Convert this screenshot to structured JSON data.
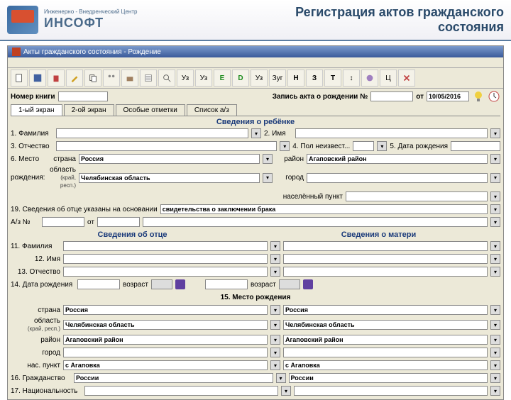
{
  "slide": {
    "logo_small": "Инженерно - Внедренческий Центр",
    "logo_big": "ИНСОФТ",
    "title_l1": "Регистрация актов гражданского",
    "title_l2": "состояния"
  },
  "window": {
    "title": "Акты гражданского состояния - Рождение"
  },
  "bookrow": {
    "lbl_book": "Номер книги",
    "lbl_record": "Запись акта о рождении №",
    "lbl_from": "от",
    "date": "10/05/2016"
  },
  "tabs": {
    "t1": "1-ый экран",
    "t2": "2-ой экран",
    "t3": "Особые отметки",
    "t4": "Список а/з"
  },
  "child": {
    "section": "Сведения о ребёнке",
    "l1": "1. Фамилия",
    "l2": "2. Имя",
    "l3": "3. Отчество",
    "l4": "4. Пол неизвест...",
    "l5": "5. Дата рождения",
    "l6": "6. Место",
    "l6b": "рождения:",
    "country_l": "страна",
    "country": "Россия",
    "region_l": "область",
    "region_sub": "(край, респ.)",
    "region": "Челябинская область",
    "district_l": "район",
    "district": "Агаповский район",
    "city_l": "город",
    "settle_l": "населённый пункт",
    "l19": "19. Сведения об отце указаны на основании",
    "l19v": "свидетельства о заключении брака",
    "az": "А/з №",
    "az_from": "от"
  },
  "parents": {
    "father": "Сведения об отце",
    "mother": "Сведения о матери",
    "l11": "11. Фамилия",
    "l12": "12. Имя",
    "l13": "13. Отчество",
    "l14": "14. Дата рождения",
    "age": "возраст",
    "l15": "15. Место рождения",
    "country_l": "страна",
    "country": "Россия",
    "region_l": "область",
    "region_sub": "(край, респ.)",
    "region": "Челябинская область",
    "district_l": "район",
    "district": "Агаповский район",
    "city_l": "город",
    "settle_l": "нас. пункт",
    "settle": "с Агаповка",
    "l16": "16. Гражданство",
    "citizenship": "России",
    "l17": "17. Национальность"
  },
  "toolbar": {
    "btns": [
      "a",
      "b",
      "c",
      "d",
      "e",
      "f",
      "g",
      "h",
      "i",
      "j",
      "k",
      "l",
      "m",
      "n",
      "o",
      "p",
      "q",
      "Н",
      "З",
      "Т",
      "r",
      "s",
      "t",
      "u"
    ]
  }
}
